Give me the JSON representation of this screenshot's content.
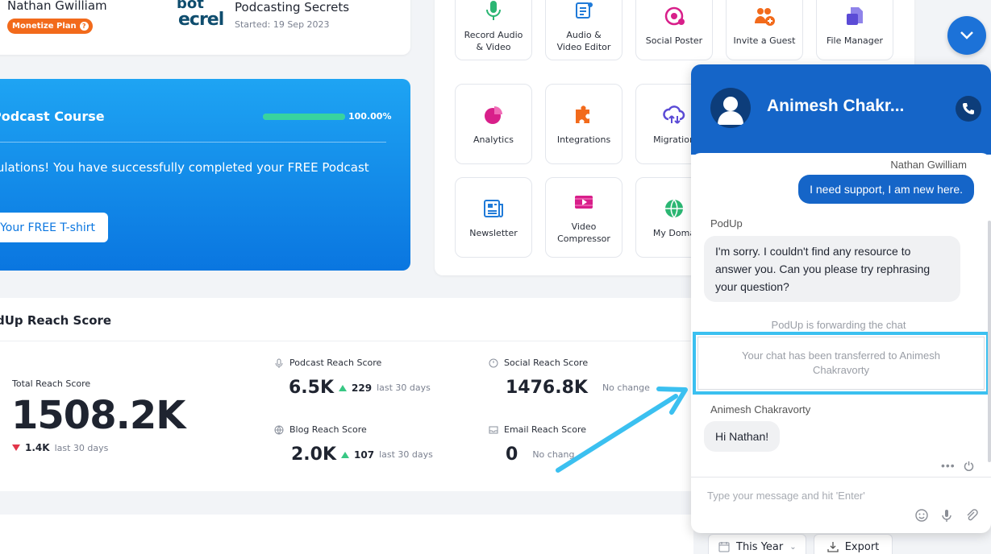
{
  "profile": {
    "user_name": "Nathan Gwilliam",
    "plan_badge": "Monetize Plan",
    "course_logo_line1": "bot",
    "course_logo_line2": "ecrel",
    "course_title": "Podcasting Secrets",
    "course_started": "Started: 19 Sep 2023"
  },
  "course_card": {
    "title": "Podcast Course",
    "progress_percent": 100,
    "progress_text": "100.00%",
    "message": "tulations! You have successfully completed your FREE Podcast",
    "tshirt_button": "Your FREE T-shirt"
  },
  "tools": [
    {
      "label": "Record Audio\n& Video",
      "icon": "microphone-icon",
      "color": "#2bb673"
    },
    {
      "label": "Audio &\nVideo Editor",
      "icon": "editor-icon",
      "color": "#1f7ad8"
    },
    {
      "label": "Social Poster",
      "icon": "social-icon",
      "color": "#d81f8a"
    },
    {
      "label": "Invite a Guest",
      "icon": "invite-guest-icon",
      "color": "#f26a1b"
    },
    {
      "label": "File Manager",
      "icon": "file-manager-icon",
      "color": "#5b4bd6"
    },
    {
      "label": "Analytics",
      "icon": "pie-chart-icon",
      "color": "#d81f8a"
    },
    {
      "label": "Integrations",
      "icon": "puzzle-icon",
      "color": "#f26a1b"
    },
    {
      "label": "Migration",
      "icon": "cloud-migration-icon",
      "color": "#5b4bd6"
    },
    {
      "label": "Newsletter",
      "icon": "newsletter-icon",
      "color": "#1f7ad8"
    },
    {
      "label": "Video\nCompressor",
      "icon": "video-compressor-icon",
      "color": "#d81f8a"
    },
    {
      "label": "My Doma",
      "icon": "globe-icon",
      "color": "#2bb673"
    }
  ],
  "reach": {
    "title": "dUp Reach Score",
    "total_label": "Total Reach Score",
    "total_value": "1508.2K",
    "total_delta": "1.4K",
    "total_delta_period": "last 30 days",
    "metrics": [
      {
        "label": "Podcast Reach Score",
        "value": "6.5K",
        "delta": "229",
        "period": "last 30 days",
        "icon": "microphone-icon"
      },
      {
        "label": "Social Reach Score",
        "value": "1476.8K",
        "delta": "",
        "period": "No change",
        "icon": "chat-bubble-icon"
      },
      {
        "label": "Blog Reach Score",
        "value": "2.0K",
        "delta": "107",
        "period": "last 30 days",
        "icon": "globe-icon"
      },
      {
        "label": "Email Reach Score",
        "value": "0",
        "delta": "",
        "period": "No chang",
        "icon": "inbox-icon"
      }
    ]
  },
  "filters": {
    "year": "This Year",
    "export": "Export"
  },
  "chat": {
    "agent_name": "Animesh Chakr...",
    "user_sender": "Nathan Gwilliam",
    "user_message": "I need support, I am new here.",
    "bot_sender": "PodUp",
    "bot_message": "I'm sorry. I couldn't find any resource to answer you. Can you please try rephrasing your question?",
    "forward_note": "PodUp is forwarding the chat",
    "transfer_note": "Your chat has been transferred to Animesh Chakravorty",
    "agent_sender": "Animesh Chakravorty",
    "agent_message": "Hi Nathan!",
    "input_placeholder": "Type your message and hit 'Enter'"
  },
  "colors": {
    "brand_blue": "#1565c8",
    "accent_orange": "#f26a1b",
    "progress_green": "#38d39f",
    "highlight_cyan": "#3bc0f0"
  }
}
